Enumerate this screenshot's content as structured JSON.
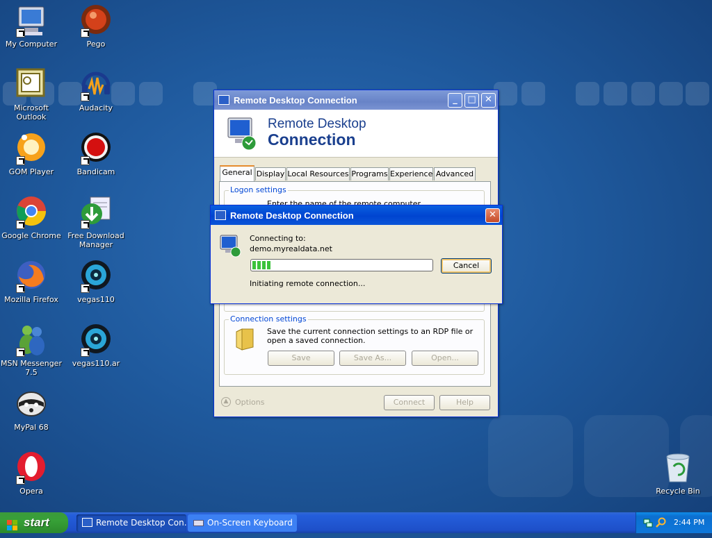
{
  "desktop": {
    "icons_left": [
      {
        "label": "My Computer",
        "icon": "computer-icon"
      },
      {
        "label": "Microsoft Outlook",
        "icon": "outlook-icon"
      },
      {
        "label": "GOM Player",
        "icon": "gom-player-icon"
      },
      {
        "label": "Google Chrome",
        "icon": "chrome-icon"
      },
      {
        "label": "Mozilla Firefox",
        "icon": "firefox-icon"
      },
      {
        "label": "MSN Messenger 7.5",
        "icon": "msn-icon"
      },
      {
        "label": "MyPal 68",
        "icon": "mypal-icon"
      },
      {
        "label": "Opera",
        "icon": "opera-icon"
      }
    ],
    "icons_right": [
      {
        "label": "Pego",
        "icon": "pego-icon"
      },
      {
        "label": "Audacity",
        "icon": "audacity-icon"
      },
      {
        "label": "Bandicam",
        "icon": "bandicam-icon"
      },
      {
        "label": "Free Download Manager",
        "icon": "fdm-icon"
      },
      {
        "label": "vegas110",
        "icon": "vegas-icon"
      },
      {
        "label": "vegas110.ar",
        "icon": "vegas-icon"
      }
    ],
    "recycle_bin": "Recycle Bin"
  },
  "rdc_window": {
    "title": "Remote Desktop Connection",
    "banner_line1": "Remote Desktop",
    "banner_line2": "Connection",
    "tabs": [
      "General",
      "Display",
      "Local Resources",
      "Programs",
      "Experience",
      "Advanced"
    ],
    "logon_settings_label": "Logon settings",
    "logon_partial_text": "Enter the name of the remote computer.",
    "connection_settings_label": "Connection settings",
    "connection_settings_text": "Save the current connection settings to an RDP file or open a saved connection.",
    "save_button": "Save",
    "save_as_button": "Save As...",
    "open_button": "Open...",
    "options_label": "Options",
    "connect_button": "Connect",
    "help_button": "Help"
  },
  "progress_dialog": {
    "title": "Remote Desktop Connection",
    "connecting_to_label": "Connecting to:",
    "host": "demo.myrealdata.net",
    "progress_fraction": 0.1,
    "cancel_button": "Cancel",
    "status": "Initiating remote connection..."
  },
  "taskbar": {
    "start_label": "start",
    "tasks": [
      "Remote Desktop Con...",
      "On-Screen Keyboard"
    ],
    "clock": "2:44 PM"
  }
}
